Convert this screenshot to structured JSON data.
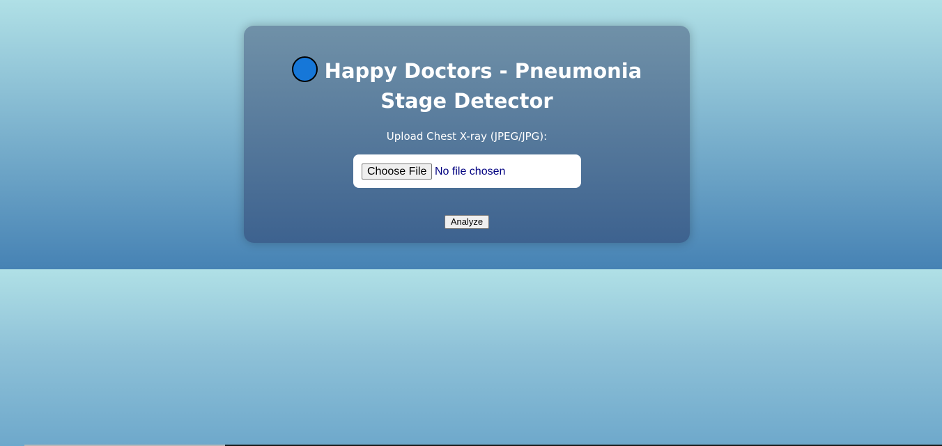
{
  "header": {
    "title": "Happy Doctors - Pneumonia Stage Detector",
    "logo_icon": "blue-circle-icon"
  },
  "form": {
    "upload_label": "Upload Chest X-ray (JPEG/JPG):",
    "choose_file_label": "Choose File",
    "file_status": "No file chosen",
    "analyze_label": "Analyze"
  },
  "colors": {
    "background_top": "#b0e0e6",
    "background_bottom": "#4682b4",
    "logo_fill": "#1677d8",
    "file_status_text": "#000080"
  }
}
